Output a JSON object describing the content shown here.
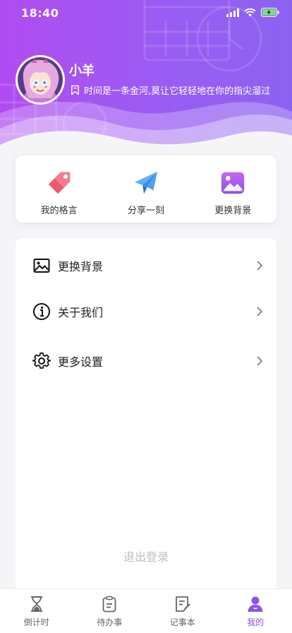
{
  "status_bar": {
    "time": "18:40"
  },
  "profile": {
    "name": "小羊",
    "motto": "时间是一条金河,莫让它轻轻地在你的指尖溜过"
  },
  "quick_actions": [
    {
      "label": "我的格言",
      "icon": "tag-icon"
    },
    {
      "label": "分享一刻",
      "icon": "paper-plane-icon"
    },
    {
      "label": "更换背景",
      "icon": "image-icon"
    }
  ],
  "menu": [
    {
      "label": "更换背景",
      "icon": "image-outline-icon"
    },
    {
      "label": "关于我们",
      "icon": "info-icon"
    },
    {
      "label": "更多设置",
      "icon": "gear-icon"
    }
  ],
  "logout_label": "退出登录",
  "tabs": [
    {
      "label": "倒计时",
      "icon": "hourglass-icon",
      "active": false
    },
    {
      "label": "待办事",
      "icon": "clipboard-icon",
      "active": false
    },
    {
      "label": "记事本",
      "icon": "notebook-icon",
      "active": false
    },
    {
      "label": "我的",
      "icon": "user-icon",
      "active": true
    }
  ],
  "colors": {
    "header_gradient_start": "#b14cf2",
    "header_gradient_end": "#8c63f0",
    "accent": "#8a52f0",
    "tag_red": "#f0586e",
    "plane_blue": "#3a8fe8",
    "image_purple": "#a056e8",
    "logout_gray": "#bdbdbd"
  }
}
